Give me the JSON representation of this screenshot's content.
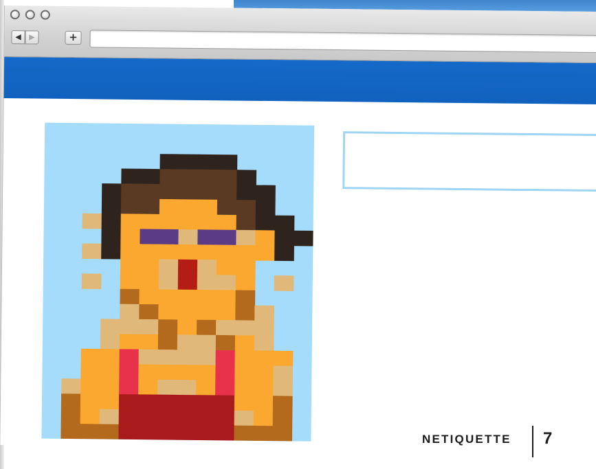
{
  "browser": {
    "back_icon": "◀",
    "forward_icon": "▶",
    "new_tab_icon": "+",
    "address": ""
  },
  "footer": {
    "section_title": "NETIQUETTE",
    "page_number": "7"
  },
  "illustration": {
    "subject": "pixel-art avatar of a person with brown hair",
    "colors": {
      "sky": "#a6dcfb",
      "hair": "#5a3a22",
      "hair_dark": "#2e231d",
      "skin": "#fba830",
      "skin_light": "#dfb87a",
      "skin_shadow": "#b36a1c",
      "eyes": "#5b3a86",
      "mouth": "#b31d14",
      "straps": "#e8324b",
      "shirt": "#a81a1c"
    }
  },
  "colors": {
    "header_band": "#1569c8",
    "textbox_border": "#9fd5f3"
  }
}
